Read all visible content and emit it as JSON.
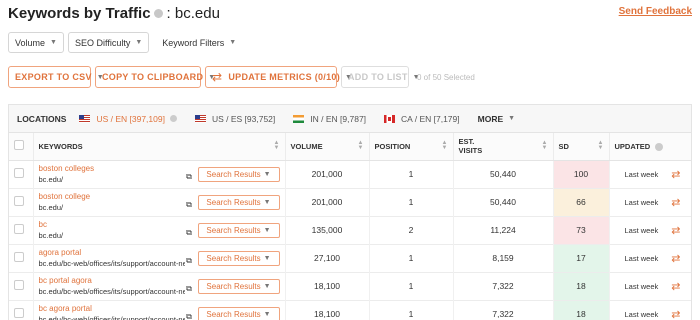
{
  "header": {
    "title_bold": "Keywords by Traffic",
    "title_domain": ": bc.edu",
    "feedback": "Send Feedback"
  },
  "filters": [
    {
      "label": "Volume",
      "icon": "chevron-down-icon"
    },
    {
      "label": "SEO Difficulty",
      "icon": "chevron-down-icon"
    },
    {
      "label": "Keyword Filters",
      "icon": "chevron-down-icon"
    }
  ],
  "actions": {
    "export": "EXPORT TO CSV",
    "clipboard": "COPY TO CLIPBOARD",
    "update": "UPDATE METRICS (0/10)",
    "add_list": "ADD TO LIST",
    "selected": "0 of 50 Selected"
  },
  "locations": {
    "label": "LOCATIONS",
    "items": [
      {
        "text": "US / EN  [397,109]",
        "flag": "us",
        "active": true
      },
      {
        "text": "US / ES  [93,752]",
        "flag": "us",
        "active": false
      },
      {
        "text": "IN / EN  [9,787]",
        "flag": "in",
        "active": false
      },
      {
        "text": "CA / EN  [7,179]",
        "flag": "ca",
        "active": false
      }
    ],
    "more": "MORE"
  },
  "columns": {
    "keywords": "KEYWORDS",
    "volume": "VOLUME",
    "position": "POSITION",
    "visits_1": "EST.",
    "visits_2": "VISITS",
    "sd": "SD",
    "updated": "UPDATED"
  },
  "rows": [
    {
      "keyword": "boston colleges",
      "url": "bc.edu/",
      "serp": "Search Results",
      "volume": "201,000",
      "position": "1",
      "visits": "50,440",
      "sd": "100",
      "sd_color": "#fbe4e6",
      "updated": "Last week"
    },
    {
      "keyword": "boston college",
      "url": "bc.edu/",
      "serp": "Search Results",
      "volume": "201,000",
      "position": "1",
      "visits": "50,440",
      "sd": "66",
      "sd_color": "#fbf0dc",
      "updated": "Last week"
    },
    {
      "keyword": "bc",
      "url": "bc.edu/",
      "serp": "Search Results",
      "volume": "135,000",
      "position": "2",
      "visits": "11,224",
      "sd": "73",
      "sd_color": "#fbe4e6",
      "updated": "Last week"
    },
    {
      "keyword": "agora portal",
      "url": "bc.edu/bc-web/offices/its/support/account-net...",
      "serp": "Search Results",
      "volume": "27,100",
      "position": "1",
      "visits": "8,159",
      "sd": "17",
      "sd_color": "#e3f5ea",
      "updated": "Last week"
    },
    {
      "keyword": "bc portal agora",
      "url": "bc.edu/bc-web/offices/its/support/account-net...",
      "serp": "Search Results",
      "volume": "18,100",
      "position": "1",
      "visits": "7,322",
      "sd": "18",
      "sd_color": "#e3f5ea",
      "updated": "Last week"
    },
    {
      "keyword": "bc agora portal",
      "url": "bc.edu/bc-web/offices/its/support/account-net...",
      "serp": "Search Results",
      "volume": "18,100",
      "position": "1",
      "visits": "7,322",
      "sd": "18",
      "sd_color": "#e3f5ea",
      "updated": "Last week"
    }
  ],
  "colors": {
    "accent": "#e0733c",
    "sd_high": "#fbe4e6",
    "sd_mid": "#fbf0dc",
    "sd_low": "#e3f5ea"
  }
}
